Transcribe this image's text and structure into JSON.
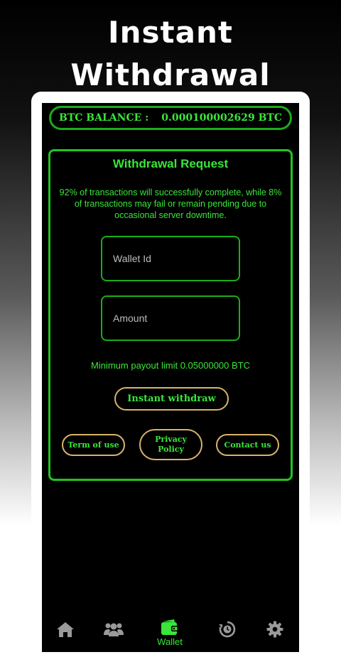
{
  "promo": {
    "headline_line1": "Instant",
    "headline_line2": "Withdrawal"
  },
  "balance": {
    "label": "BTC BALANCE :",
    "value": "0.000100002629 BTC"
  },
  "withdrawal_card": {
    "title": "Withdrawal Request",
    "note": "92% of transactions will successfully complete, while 8% of transactions may fail or remain pending due to occasional server downtime.",
    "wallet_id": {
      "placeholder": "Wallet Id",
      "value": ""
    },
    "amount": {
      "placeholder": "Amount",
      "value": ""
    },
    "min_payout": "Minimum payout limit 0.05000000 BTC",
    "withdraw_button": "Instant withdraw",
    "terms_button": "Term of use",
    "privacy_button": "Privacy Policy",
    "contact_button": "Contact us"
  },
  "bottom_nav": {
    "items": [
      {
        "icon": "home-icon",
        "label": ""
      },
      {
        "icon": "users-icon",
        "label": ""
      },
      {
        "icon": "wallet-icon",
        "label": "Wallet",
        "active": true
      },
      {
        "icon": "history-icon",
        "label": ""
      },
      {
        "icon": "gear-icon",
        "label": ""
      }
    ]
  },
  "colors": {
    "accent_green": "#39e639",
    "border_green": "#1aad1a",
    "button_gold": "#d8b36a",
    "inactive_icon": "#9a9a9a"
  }
}
